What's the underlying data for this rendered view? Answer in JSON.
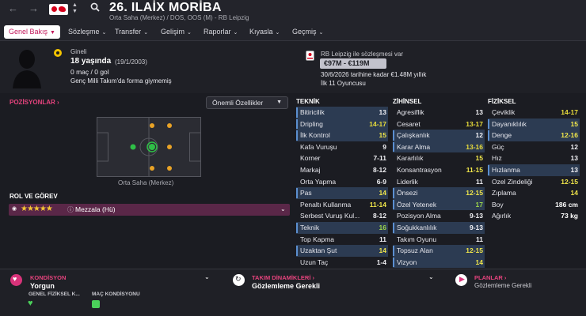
{
  "header": {
    "player_title": "26. ILAİX MORİBA",
    "subtitle": "Orta Saha (Merkez) / DOS, OOS (M) - RB Leipzig"
  },
  "tabs": [
    {
      "label": "Genel Bakış"
    },
    {
      "label": "Sözleşme"
    },
    {
      "label": "Transfer"
    },
    {
      "label": "Gelişim"
    },
    {
      "label": "Raporlar"
    },
    {
      "label": "Kıyasla"
    },
    {
      "label": "Geçmiş"
    }
  ],
  "info": {
    "nationality_label": "Gineli",
    "age": "18 yaşında",
    "dob": "(19/1/2003)",
    "stats": "0 maç / 0 gol",
    "youth_caps": "Genç Milli Takım'da forma giymemiş",
    "contract_header": "RB Leipzig ile sözleşmesi var",
    "value_range": "€97M - €119M",
    "contract_line": "30/6/2026 tarihine kadar €1.48M yıllık",
    "squad_status": "İlk 11 Oyuncusu"
  },
  "positions": {
    "link_label": "POZİSYONLAR",
    "dropdown_label": "Önemli Özellikler",
    "position_caption": "Orta Saha (Merkez)",
    "role_section": "ROL VE GÖREV",
    "role_name": "Mezzala (Hü)"
  },
  "attributes": {
    "technical": {
      "title": "TEKNİK",
      "rows": [
        {
          "name": "Bitiricilik",
          "value": "13",
          "hl": true,
          "color": "#f0f0f4"
        },
        {
          "name": "Dripling",
          "value": "14-17",
          "hl": true,
          "color": "#e8dc3a"
        },
        {
          "name": "İlk Kontrol",
          "value": "15",
          "hl": true,
          "color": "#f0e64a"
        },
        {
          "name": "Kafa Vuruşu",
          "value": "9",
          "hl": false,
          "color": "#f0f0f4"
        },
        {
          "name": "Korner",
          "value": "7-11",
          "hl": false,
          "color": "#f0f0f4"
        },
        {
          "name": "Markaj",
          "value": "8-12",
          "hl": false,
          "color": "#f0f0f4"
        },
        {
          "name": "Orta Yapma",
          "value": "6-9",
          "hl": false,
          "color": "#f0f0f4"
        },
        {
          "name": "Pas",
          "value": "14",
          "hl": true,
          "color": "#f0e64a"
        },
        {
          "name": "Penaltı Kullanma",
          "value": "11-14",
          "hl": false,
          "color": "#f0e64a"
        },
        {
          "name": "Serbest Vuruş Kul...",
          "value": "8-12",
          "hl": false,
          "color": "#f0f0f4"
        },
        {
          "name": "Teknik",
          "value": "16",
          "hl": true,
          "color": "#9cd64a"
        },
        {
          "name": "Top Kapma",
          "value": "11",
          "hl": false,
          "color": "#f0f0f4"
        },
        {
          "name": "Uzaktan Şut",
          "value": "14",
          "hl": true,
          "color": "#f0e64a"
        },
        {
          "name": "Uzun Taç",
          "value": "1-4",
          "hl": false,
          "color": "#f0f0f4"
        }
      ]
    },
    "mental": {
      "title": "ZİHİNSEL",
      "rows": [
        {
          "name": "Agresiflik",
          "value": "13",
          "hl": false,
          "color": "#f0f0f4"
        },
        {
          "name": "Cesaret",
          "value": "13-17",
          "hl": false,
          "color": "#e8dc3a"
        },
        {
          "name": "Çalışkanlık",
          "value": "12",
          "hl": true,
          "color": "#f0f0f4"
        },
        {
          "name": "Karar Alma",
          "value": "13-16",
          "hl": true,
          "color": "#e8dc3a"
        },
        {
          "name": "Kararlılık",
          "value": "15",
          "hl": false,
          "color": "#f0e64a"
        },
        {
          "name": "Konsantrasyon",
          "value": "11-15",
          "hl": false,
          "color": "#f0e64a"
        },
        {
          "name": "Liderlik",
          "value": "11",
          "hl": false,
          "color": "#f0f0f4"
        },
        {
          "name": "Önsezi",
          "value": "12-15",
          "hl": true,
          "color": "#f0e64a"
        },
        {
          "name": "Özel Yetenek",
          "value": "17",
          "hl": true,
          "color": "#9cd64a"
        },
        {
          "name": "Pozisyon Alma",
          "value": "9-13",
          "hl": false,
          "color": "#f0f0f4"
        },
        {
          "name": "Soğukkanlılık",
          "value": "9-13",
          "hl": true,
          "color": "#f0f0f4"
        },
        {
          "name": "Takım Oyunu",
          "value": "11",
          "hl": false,
          "color": "#f0f0f4"
        },
        {
          "name": "Topsuz Alan",
          "value": "12-15",
          "hl": true,
          "color": "#f0e64a"
        },
        {
          "name": "Vizyon",
          "value": "14",
          "hl": true,
          "color": "#f0e64a"
        }
      ]
    },
    "physical": {
      "title": "FİZİKSEL",
      "rows": [
        {
          "name": "Çeviklik",
          "value": "14-17",
          "hl": false,
          "color": "#e8dc3a"
        },
        {
          "name": "Dayanıklılık",
          "value": "15",
          "hl": true,
          "color": "#f0e64a"
        },
        {
          "name": "Denge",
          "value": "12-16",
          "hl": true,
          "color": "#f0e64a"
        },
        {
          "name": "Güç",
          "value": "12",
          "hl": false,
          "color": "#f0f0f4"
        },
        {
          "name": "Hız",
          "value": "13",
          "hl": false,
          "color": "#f0f0f4"
        },
        {
          "name": "Hızlanma",
          "value": "13",
          "hl": true,
          "color": "#f0f0f4"
        },
        {
          "name": "Ozel Zindeliği",
          "value": "12-15",
          "hl": false,
          "color": "#f0e64a"
        },
        {
          "name": "Zıplama",
          "value": "14",
          "hl": false,
          "color": "#f0e64a"
        }
      ],
      "height_label": "Boy",
      "height_value": "186 cm",
      "weight_label": "Ağırlık",
      "weight_value": "73 kg"
    }
  },
  "bottom": {
    "condition_title": "KONDİSYON",
    "condition_value": "Yorgun",
    "sub1": "GENEL FİZİKSEL K...",
    "sub2": "MAÇ KONDİSYONU",
    "team_title": "TAKIM DİNAMİKLERİ",
    "team_value": "Gözlemleme Gerekli",
    "plans_title": "PLANLAR",
    "plans_value": "Gözlemleme Gerekli"
  },
  "colors": {
    "accent": "#e5437d",
    "highlight_row": "#2c3b52",
    "role_bar": "#5a2748"
  }
}
